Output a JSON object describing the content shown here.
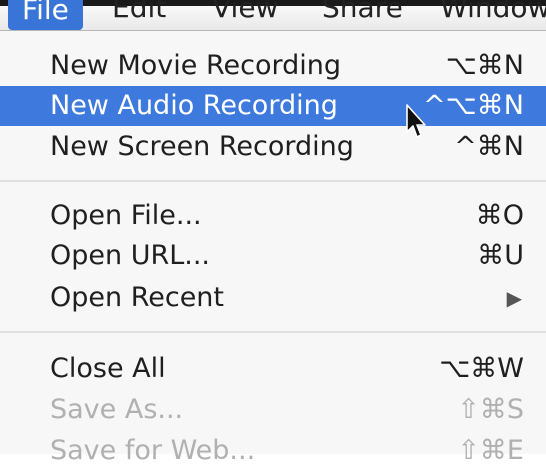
{
  "menubar": {
    "menus": [
      "File",
      "Edit",
      "View",
      "Share",
      "Window"
    ]
  },
  "menu": {
    "groups": [
      [
        {
          "label": "New Movie Recording",
          "shortcut": "⌥⌘N",
          "state": "normal"
        },
        {
          "label": "New Audio Recording",
          "shortcut": "^⌥⌘N",
          "state": "highlighted"
        },
        {
          "label": "New Screen Recording",
          "shortcut": "^⌘N",
          "state": "normal"
        }
      ],
      [
        {
          "label": "Open File...",
          "shortcut": "⌘O",
          "state": "normal"
        },
        {
          "label": "Open URL...",
          "shortcut": "⌘U",
          "state": "normal"
        },
        {
          "label": "Open Recent",
          "shortcut": "▶",
          "state": "submenu"
        }
      ],
      [
        {
          "label": "Close All",
          "shortcut": "⌥⌘W",
          "state": "normal"
        },
        {
          "label": "Save As...",
          "shortcut": "⇧⌘S",
          "state": "disabled"
        },
        {
          "label": "Save for Web...",
          "shortcut": "⇧⌘E",
          "state": "disabled"
        }
      ]
    ]
  },
  "icons": {
    "cursor": "mouse-pointer-icon",
    "submenu": "triangle-right-icon"
  },
  "colors": {
    "highlight": "#3e7ade",
    "disabled_text": "#b0b0b0"
  }
}
